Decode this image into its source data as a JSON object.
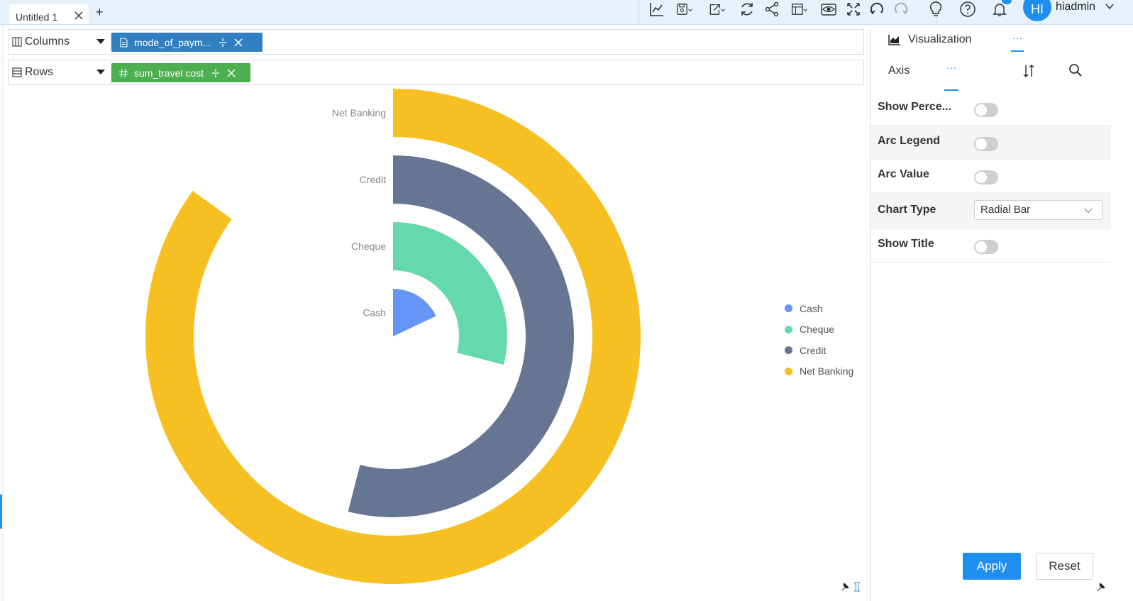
{
  "tabs": {
    "active_title": "Untitled 1",
    "add_label": "+"
  },
  "toolbar": {
    "icons": [
      "line-chart-icon",
      "save-icon",
      "export-icon",
      "refresh-icon",
      "share-icon",
      "layout-icon",
      "preview-eye-icon",
      "fullscreen-icon",
      "undo-icon",
      "redo-icon",
      "lightbulb-icon",
      "help-icon",
      "bell-icon"
    ]
  },
  "user": {
    "initials": "HI",
    "name": "hiadmin"
  },
  "shelves": {
    "columns": {
      "label": "Columns",
      "pill": "mode_of_paym..."
    },
    "rows": {
      "label": "Rows",
      "pill": "sum_travel cost"
    }
  },
  "chart_data": {
    "type": "radial bar",
    "categories": [
      "Cash",
      "Cheque",
      "Credit",
      "Net Banking"
    ],
    "series": [
      {
        "values": [
          0.18,
          0.29,
          0.54,
          0.85
        ]
      }
    ],
    "colors": [
      "#6495f7",
      "#65d9ab",
      "#657592",
      "#f7c022"
    ],
    "legend": {
      "position": "right",
      "entries": [
        "Cash",
        "Cheque",
        "Credit",
        "Net Banking"
      ]
    },
    "title": "",
    "xlabel": "",
    "ylabel": ""
  },
  "panel": {
    "tab_label": "Visualization",
    "more_label": "···",
    "subtab_label": "Axis",
    "subtab_more_label": "···",
    "properties": [
      {
        "label": "Show Perce...",
        "enabled": false
      },
      {
        "label": "Arc Legend",
        "enabled": false
      },
      {
        "label": "Arc Value",
        "enabled": false
      },
      {
        "label": "Chart Type",
        "value": "Radial Bar"
      },
      {
        "label": "Show Title",
        "enabled": false
      }
    ],
    "apply_label": "Apply",
    "reset_label": "Reset"
  }
}
